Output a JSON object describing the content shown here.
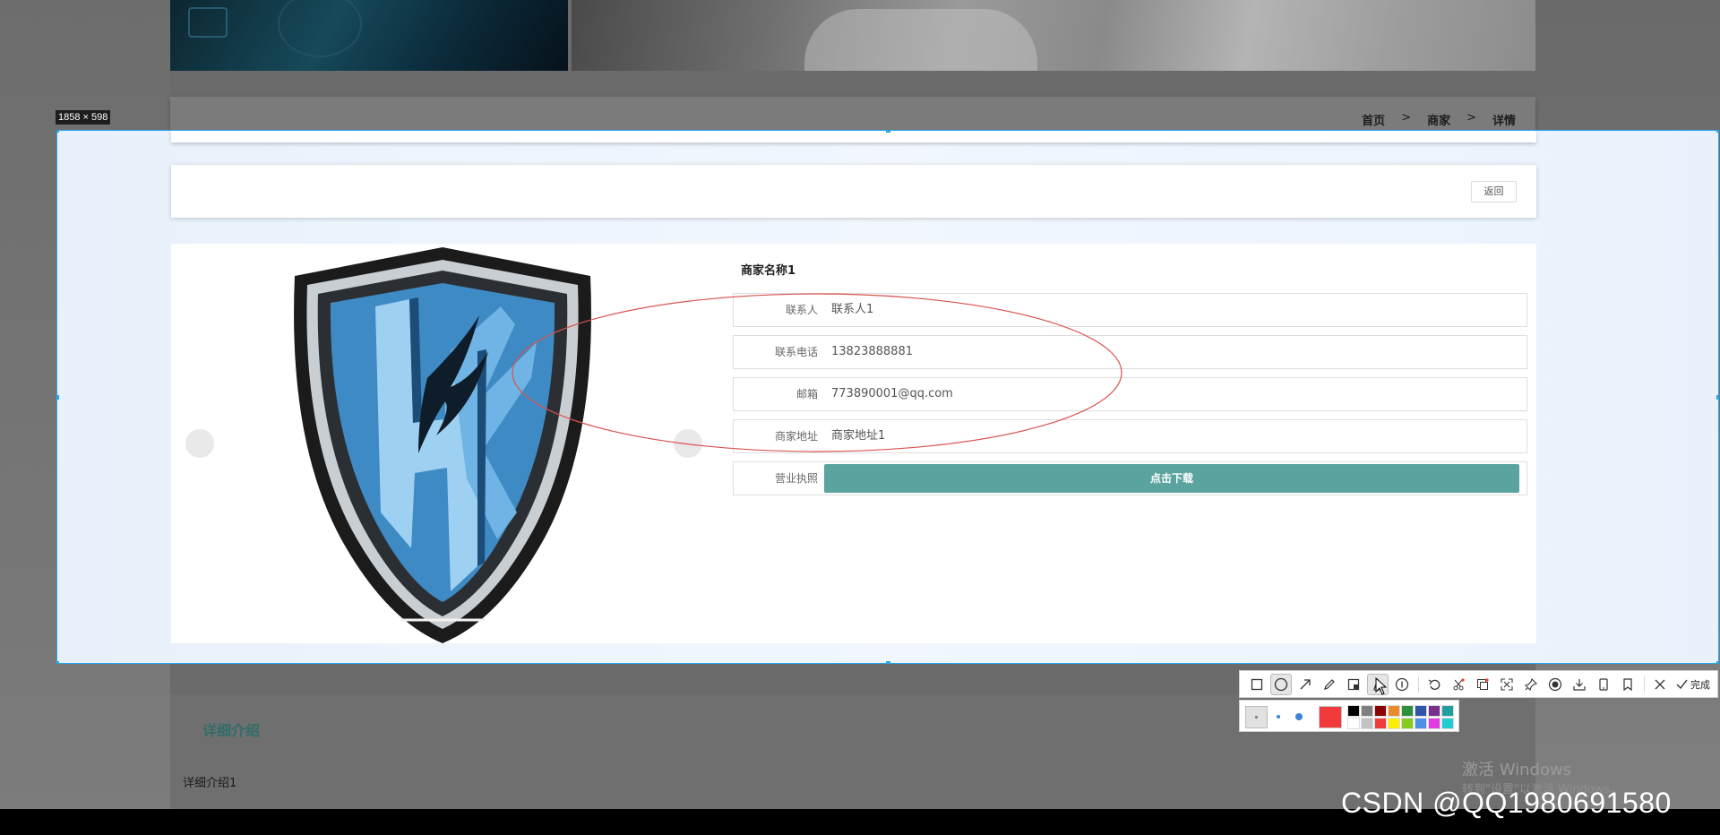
{
  "breadcrumb": {
    "home": "首页",
    "merchants": "商家",
    "detail": "详情",
    "separator": ">"
  },
  "capture": {
    "size_label": "1858 × 598"
  },
  "top_card": {
    "back_label": "返回"
  },
  "merchant": {
    "name": "商家名称1",
    "fields": [
      {
        "label": "联系人",
        "value": "联系人1"
      },
      {
        "label": "联系电话",
        "value": "13823888881"
      },
      {
        "label": "邮箱",
        "value": "773890001@qq.com"
      },
      {
        "label": "商家地址",
        "value": "商家地址1"
      }
    ],
    "license": {
      "label": "营业执照",
      "button": "点击下载"
    }
  },
  "intro": {
    "title": "详细介绍",
    "text": "详细介绍1"
  },
  "toolbar": {
    "done_label": "完成",
    "tools": [
      "rectangle-icon",
      "ellipse-icon",
      "arrow-icon",
      "pencil-icon",
      "mosaic-icon",
      "text-icon",
      "number-icon",
      "undo-icon",
      "clip-icon",
      "ocr-icon",
      "scroll-capture-icon",
      "record-icon",
      "pin-icon",
      "download-icon",
      "phone-icon",
      "bookmark-icon",
      "close-icon",
      "check-icon"
    ],
    "active_tool": "text-icon",
    "current_color": "#f2393b",
    "swatches": [
      "#000000",
      "#7f7f7f",
      "#8b0000",
      "#e98b2a",
      "#2f8f3f",
      "#2f55a8",
      "#7a2f8f",
      "#1f9e9e",
      "#ffffff",
      "#c3c3c3",
      "#f23b3b",
      "#ffee00",
      "#88cc22",
      "#4b8fe6",
      "#e23be0",
      "#22cdd0"
    ]
  },
  "watermarks": {
    "windows_line1": "激活 Windows",
    "windows_line2": "转到\"设置\"以激活 Windows。",
    "csdn": "CSDN @QQ1980691580"
  },
  "colors": {
    "accent": "#5aa39e",
    "selection": "#22a7f0",
    "annotation": "#d9534f"
  }
}
